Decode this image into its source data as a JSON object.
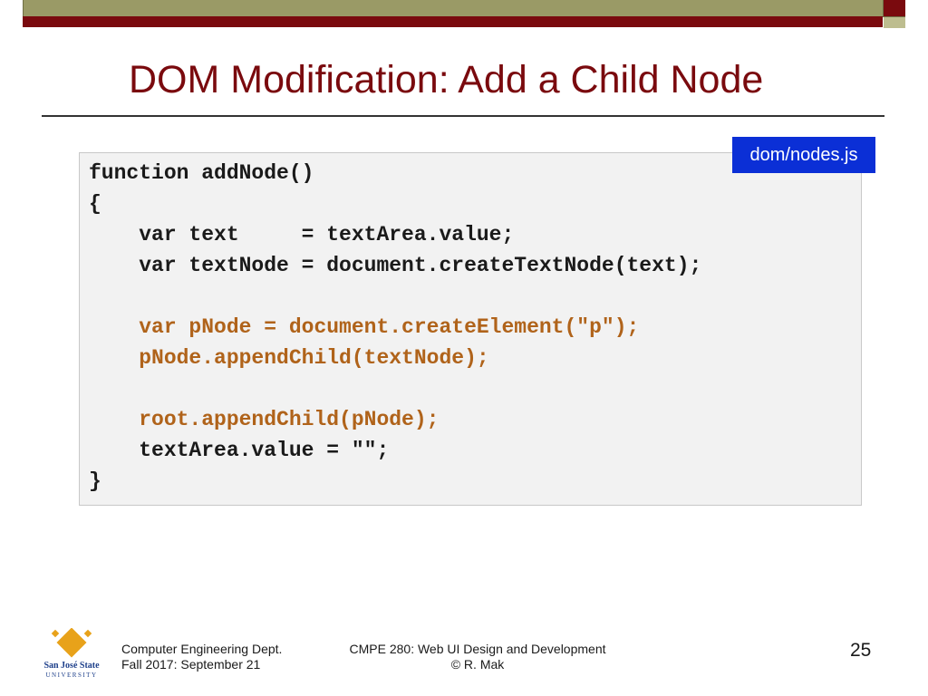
{
  "slide": {
    "title": "DOM Modification: Add a Child Node",
    "file_badge": "dom/nodes.js",
    "code_lines": [
      {
        "text": "function addNode()",
        "highlight": false
      },
      {
        "text": "{",
        "highlight": false
      },
      {
        "text": "    var text     = textArea.value;",
        "highlight": false
      },
      {
        "text": "    var textNode = document.createTextNode(text);",
        "highlight": false
      },
      {
        "text": "",
        "highlight": false
      },
      {
        "text": "    var pNode = document.createElement(\"p\");",
        "highlight": true
      },
      {
        "text": "    pNode.appendChild(textNode);",
        "highlight": true
      },
      {
        "text": "",
        "highlight": false
      },
      {
        "text": "    root.appendChild(pNode);",
        "highlight": true
      },
      {
        "text": "    textArea.value = \"\";",
        "highlight": false
      },
      {
        "text": "}",
        "highlight": false
      }
    ]
  },
  "footer": {
    "left_line1": "Computer Engineering Dept.",
    "left_line2": "Fall 2017: September 21",
    "center_line1": "CMPE 280: Web UI Design and Development",
    "center_line2": "© R. Mak",
    "page_number": "25",
    "logo_line1": "San José State",
    "logo_line2": "UNIVERSITY"
  },
  "colors": {
    "title": "#7a0a0e",
    "highlight_code": "#b0631a",
    "badge_bg": "#0b2fd6",
    "logo_gold": "#e8a21a",
    "logo_blue": "#1d3f8a"
  }
}
